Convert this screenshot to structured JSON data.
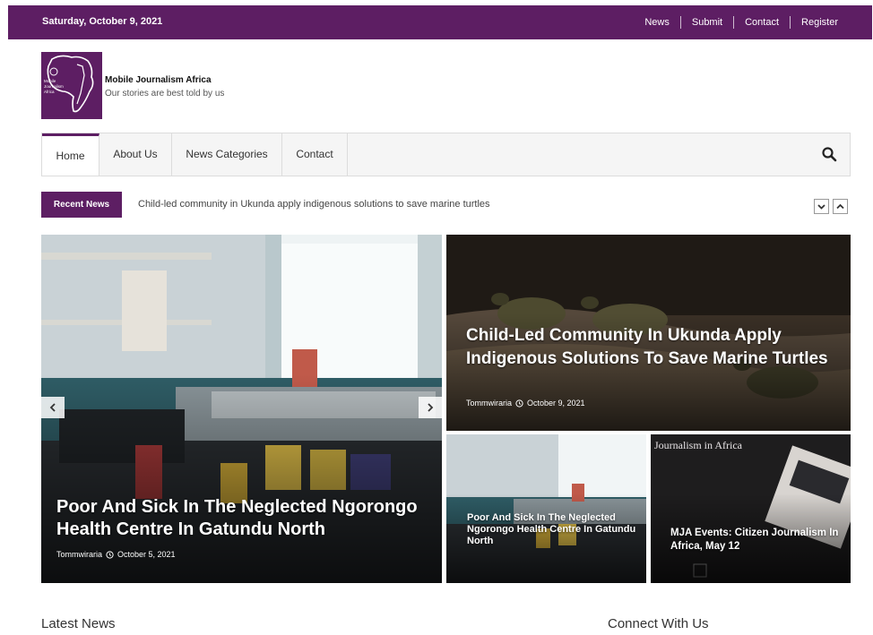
{
  "topbar": {
    "date": "Saturday, October 9, 2021",
    "links": [
      "News",
      "Submit",
      "Contact",
      "Register"
    ]
  },
  "brand": {
    "name": "Mobile Journalism Africa",
    "tagline": "Our stories are best told by us",
    "logo_text": [
      "Mobile",
      "Journalism",
      "Africa"
    ],
    "logo_caption": "Our Stories are best told by us"
  },
  "nav": {
    "items": [
      "Home",
      "About Us",
      "News Categories",
      "Contact"
    ],
    "active": "Home",
    "search_icon": "search-icon"
  },
  "ticker": {
    "label": "Recent News",
    "headline": "Child-led community in Ukunda apply indigenous solutions to save marine turtles"
  },
  "slides": {
    "main": {
      "title": "Poor And Sick In The Neglected Ngorongo Health Centre In Gatundu North",
      "author": "Tommwiraria",
      "date": "October 5, 2021"
    },
    "top_right": {
      "title": "Child-Led Community In Ukunda Apply Indigenous Solutions To Save Marine Turtles",
      "author": "Tommwiraria",
      "date": "October 9, 2021"
    },
    "bottom_left": {
      "title": "Poor And Sick In The Neglected Ngorongo Health Centre In Gatundu North"
    },
    "bottom_right": {
      "title": "MJA Events: Citizen Journalism In Africa, May 12",
      "overlay_text": "Journalism in Africa"
    }
  },
  "sections": {
    "latest": "Latest News",
    "connect": "Connect With Us"
  },
  "colors": {
    "brand": "#5d1e63"
  }
}
